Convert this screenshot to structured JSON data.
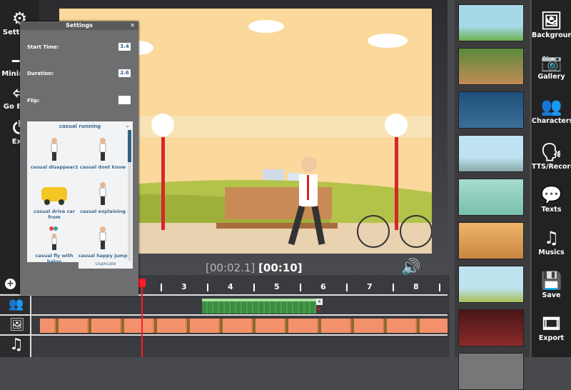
{
  "left_sidebar": [
    {
      "icon": "gear-icon",
      "glyph": "⚙",
      "label": "Settings"
    },
    {
      "icon": "minimize-icon",
      "glyph": "—",
      "label": "Minimize"
    },
    {
      "icon": "go-back-icon",
      "glyph": "⇦",
      "label": "Go Back"
    },
    {
      "icon": "power-icon",
      "glyph": "⏻",
      "label": "Exit"
    }
  ],
  "settings": {
    "title": "Settings",
    "close": "✕",
    "start_label": "Start Time:",
    "start_value": "3.4",
    "duration_label": "Duration:",
    "duration_value": "2.6",
    "flip_label": "Flip:",
    "animation_selected": "casual running",
    "animations": [
      "casual disappear2",
      "casual dont know",
      "casual drive car from",
      "casual explaining",
      "casual fly with baloo",
      "casual happy jump"
    ],
    "hidden_item": "Duplicate"
  },
  "player": {
    "current": "[00:02.1]",
    "total": "[00:10]"
  },
  "timeline": {
    "ticks": [
      "3",
      "4",
      "5",
      "6",
      "7",
      "8"
    ],
    "playhead_seconds": 2.1,
    "clip": {
      "start": 3.4,
      "duration": 2.6,
      "remove": "x"
    }
  },
  "right_sidebar": [
    {
      "icon": "image-icon",
      "glyph": "🖼",
      "label": "Backgrounds"
    },
    {
      "icon": "camera-icon",
      "glyph": "📷",
      "label": "Gallery"
    },
    {
      "icon": "characters-icon",
      "glyph": "👥",
      "label": "Characters"
    },
    {
      "icon": "tts-icon",
      "glyph": "🗣",
      "label": "TTS/Record"
    },
    {
      "icon": "speech-bubble-icon",
      "glyph": "💬",
      "label": "Texts"
    },
    {
      "icon": "music-icon",
      "glyph": "♫",
      "label": "Musics"
    },
    {
      "icon": "save-icon",
      "glyph": "💾",
      "label": "Save"
    },
    {
      "icon": "export-icon",
      "glyph": "🎞",
      "label": "Export"
    }
  ],
  "colors": {
    "accent": "#ff1a2a",
    "clip": "#3f8f45"
  }
}
